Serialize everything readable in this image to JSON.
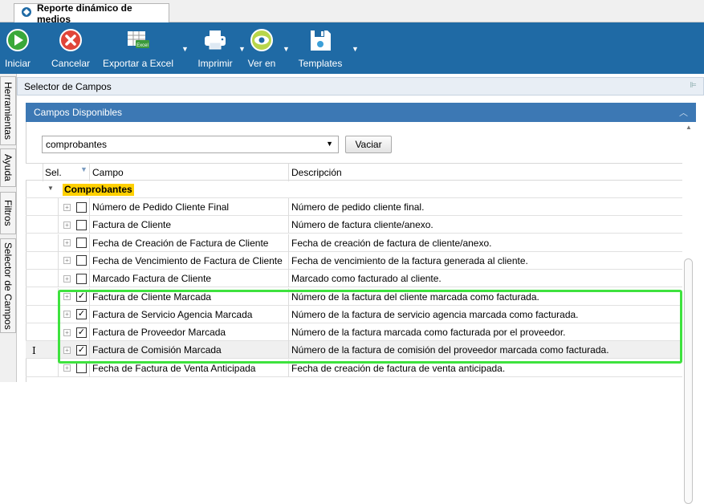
{
  "window": {
    "tab_title": "Reporte dinámico de medios"
  },
  "toolbar": {
    "iniciar": "Iniciar",
    "cancelar": "Cancelar",
    "exportar": "Exportar a Excel",
    "excel_badge": "Excel",
    "imprimir": "Imprimir",
    "ver_en": "Ver en",
    "templates": "Templates"
  },
  "side_tabs": [
    "Herramientas",
    "Ayuda",
    "Filtros",
    "Selector de Campos"
  ],
  "panel": {
    "title": "Selector de Campos",
    "section_title": "Campos Disponibles"
  },
  "filter": {
    "value": "comprobantes",
    "clear_label": "Vaciar"
  },
  "grid": {
    "columns": {
      "sel": "Sel.",
      "campo": "Campo",
      "descripcion": "Descripción"
    },
    "group": "Comprobantes",
    "rows": [
      {
        "campo": "Número de Pedido Cliente Final",
        "descripcion": "Número de pedido cliente final.",
        "checked": false
      },
      {
        "campo": "Factura de Cliente",
        "descripcion": "Número de factura cliente/anexo.",
        "checked": false
      },
      {
        "campo": "Fecha de Creación de Factura de Cliente",
        "descripcion": "Fecha de creación de factura de cliente/anexo.",
        "checked": false
      },
      {
        "campo": "Fecha de Vencimiento de Factura de Cliente",
        "descripcion": "Fecha de vencimiento de la factura generada al cliente.",
        "checked": false
      },
      {
        "campo": "Marcado Factura de Cliente",
        "descripcion": "Marcado como facturado al cliente.",
        "checked": false
      },
      {
        "campo": "Factura de Cliente Marcada",
        "descripcion": "Número de la factura del cliente marcada como facturada.",
        "checked": true
      },
      {
        "campo": "Factura de Servicio Agencia Marcada",
        "descripcion": "Número de la factura de servicio agencia marcada como facturada.",
        "checked": true
      },
      {
        "campo": "Factura de Proveedor Marcada",
        "descripcion": "Número de la factura marcada como facturada por el proveedor.",
        "checked": true
      },
      {
        "campo": "Factura de Comisión Marcada",
        "descripcion": "Número de la factura de comisión del proveedor marcada como facturada.",
        "checked": true
      },
      {
        "campo": "Fecha de Factura de Venta Anticipada",
        "descripcion": "Fecha de creación de factura de venta anticipada.",
        "checked": false
      }
    ]
  },
  "colors": {
    "ribbon": "#1f6aa5",
    "section_header": "#3c78b4",
    "group_highlight": "#ffd000",
    "selection_outline": "#3ee23e"
  },
  "icons": [
    "app-icon",
    "play-icon",
    "cancel-icon",
    "excel-icon",
    "printer-icon",
    "eye-icon",
    "save-template-icon"
  ]
}
